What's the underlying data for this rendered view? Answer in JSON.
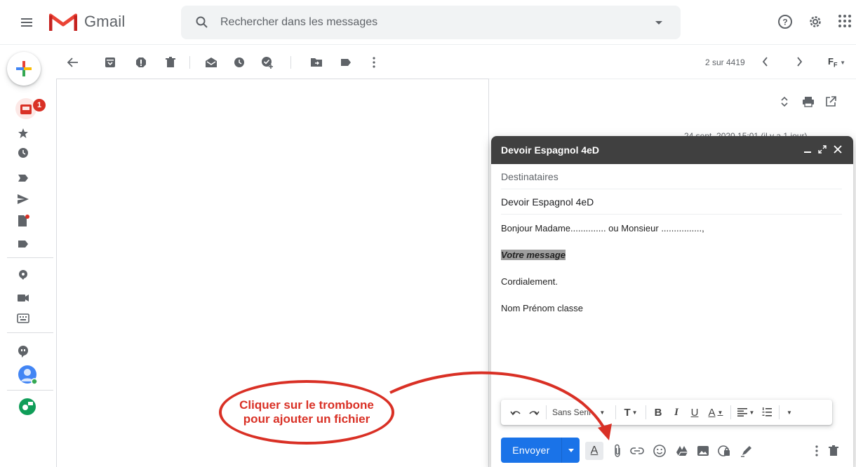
{
  "app": {
    "name": "Gmail",
    "search_placeholder": "Rechercher dans les messages"
  },
  "rail": {
    "inbox_badge": "1"
  },
  "toolbar": {
    "pager_text": "2 sur 4419",
    "lang_label": "F"
  },
  "reader": {
    "date_text": "24 sept. 2020 15:01 (il y a 1 jour)"
  },
  "compose": {
    "title": "Devoir Espagnol 4eD",
    "to_placeholder": "Destinataires",
    "subject": "Devoir Espagnol 4eD",
    "body": {
      "line1": "Bonjour Madame.............. ou Monsieur ................,",
      "line2": "Votre message",
      "line3": "Cordialement.",
      "line4": "Nom Prénom classe"
    },
    "format_bar": {
      "font": "Sans Serif"
    },
    "send_label": "Envoyer"
  },
  "annotation": {
    "line1": "Cliquer sur le trombone",
    "line2": "pour ajouter un fichier",
    "color": "#d93025"
  },
  "colors": {
    "gmail_red": "#ea4335",
    "send_blue": "#1a73e8",
    "compose_header": "#404040"
  }
}
